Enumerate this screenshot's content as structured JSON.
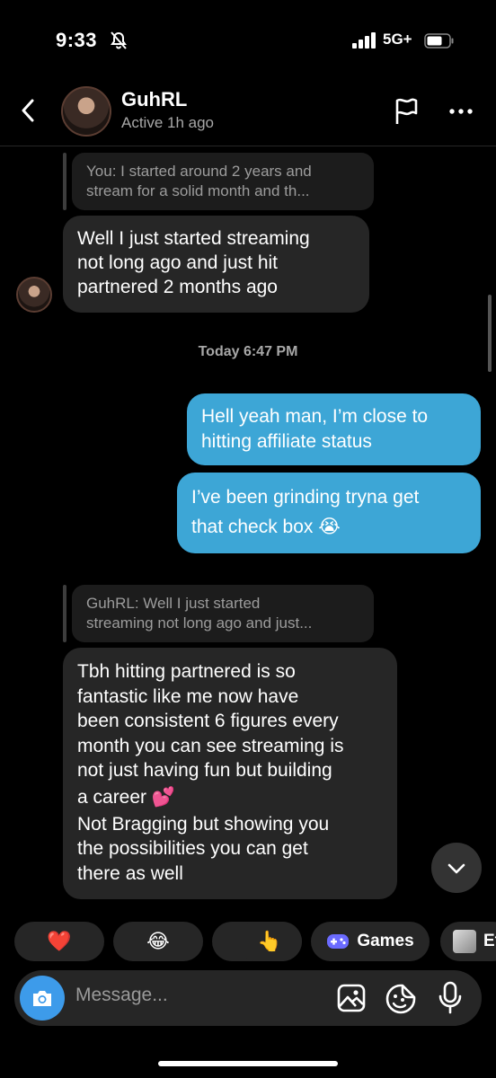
{
  "status_bar": {
    "time": "9:33",
    "network": "5G+"
  },
  "header": {
    "name": "GuhRL",
    "status": "Active 1h ago"
  },
  "messages": {
    "reply1": [
      "You: I started around 2 years and",
      "stream for a solid month and th..."
    ],
    "msg1": [
      "Well I just started streaming",
      "not long ago and just hit",
      "partnered 2 months ago"
    ],
    "timestamp": "Today 6:47 PM",
    "out1": [
      "Hell yeah man, I’m close to",
      "hitting affiliate status"
    ],
    "out2": [
      "I’ve been grinding tryna get",
      "that check box 😭"
    ],
    "reply2": [
      "GuhRL: Well I just started",
      "streaming not long ago and just..."
    ],
    "msg2": [
      "Tbh hitting partnered is so",
      "fantastic like me now have",
      "been consistent 6 figures every",
      "month you can see streaming is",
      "not just having fun but building",
      "a career 💕",
      "Not Bragging but showing you",
      "the possibilities you can get",
      "there as well"
    ]
  },
  "quick_replies": {
    "heart": "❤️",
    "laugh": "😂",
    "thumbs": "👍",
    "point": "👆",
    "games": "Games",
    "cut": "Ef"
  },
  "composer": {
    "placeholder": "Message..."
  },
  "colors": {
    "outgoing": "#3da6d6",
    "incoming": "#262626",
    "camera": "#3d9bea"
  }
}
